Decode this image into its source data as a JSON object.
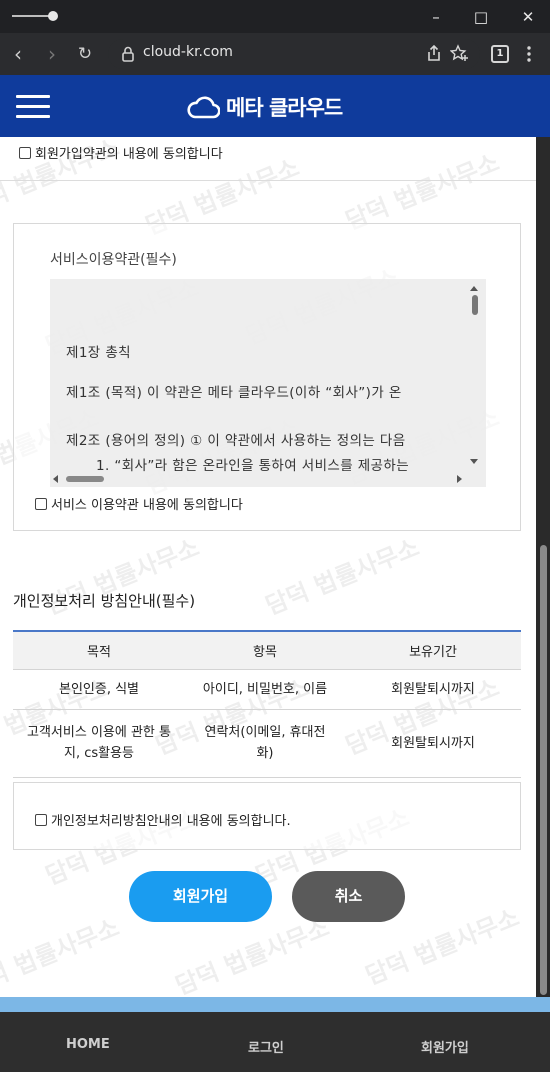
{
  "browser": {
    "url": "cloud-kr.com",
    "tab_count": "1",
    "back_icon": "arrow-left-icon",
    "forward_icon": "arrow-right-icon",
    "reload_icon": "reload-icon",
    "menu_icon": "kebab-menu-icon"
  },
  "header": {
    "logo_text": "메타 클라우드",
    "bg_color": "#0f3b9c"
  },
  "signup_terms": {
    "agree_label": "회원가입약관의 내용에 동의합니다"
  },
  "service_terms": {
    "title": "서비스이용약관(필수)",
    "lines": [
      "제1장 총칙",
      "제1조 (목적) 이 약관은 메타 클라우드(이하 “회사”)가 온",
      "제2조 (용어의 정의) ① 이 약관에서 사용하는 정의는 다음",
      "1. “회사”라 함은 온라인을 통하여 서비스를 제공하는"
    ],
    "agree_label": "서비스 이용약관 내용에 동의합니다"
  },
  "privacy": {
    "title": "개인정보처리 방침안내(필수)",
    "columns": [
      "목적",
      "항목",
      "보유기간"
    ],
    "rows": [
      [
        "본인인증, 식별",
        "아이디, 비밀번호, 이름",
        "회원탈퇴시까지"
      ],
      [
        "고객서비스 이용에 관한 통지, cs활용등",
        "연락처(이메일, 휴대전화)",
        "회원탈퇴시까지"
      ]
    ],
    "agree_label": "개인정보처리방침안내의 내용에 동의합니다."
  },
  "buttons": {
    "join": "회원가입",
    "cancel": "취소",
    "join_color": "#1a9cf0",
    "cancel_color": "#5a5a5a"
  },
  "watermark": "담덕 법률사무소",
  "footer": {
    "items": [
      "HOME",
      "로그인",
      "회원가입"
    ]
  }
}
